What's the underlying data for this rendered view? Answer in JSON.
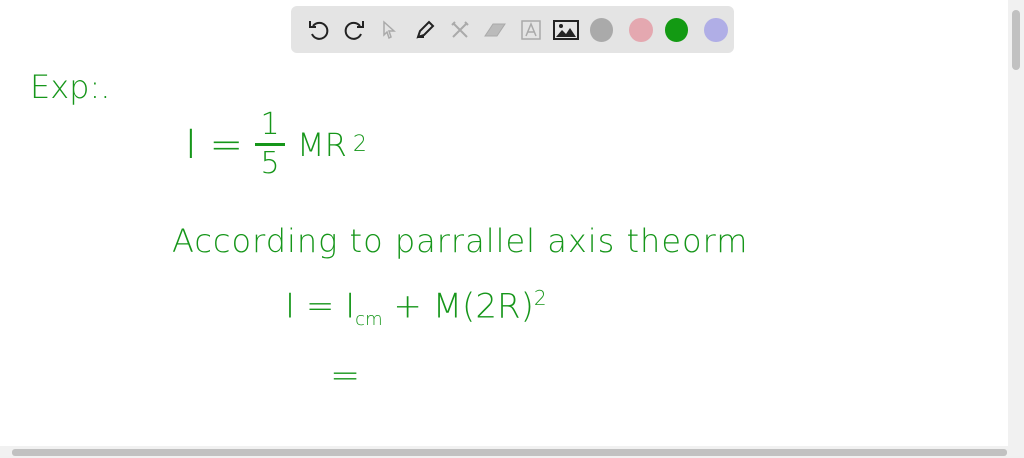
{
  "toolbar": {
    "tools": [
      "undo-icon",
      "redo-icon",
      "select-icon",
      "pen-icon",
      "tools-icon",
      "eraser-icon",
      "text-icon",
      "image-icon"
    ],
    "colors": [
      "#aaaaaa",
      "#e4a8b0",
      "#139a13",
      "#b0aee6"
    ],
    "selected_color": "#139a13"
  },
  "board": {
    "line1": "Exp:.",
    "line2_lhs": "I =",
    "line2_num": "1",
    "line2_den": "5",
    "line2_rhs": "MR",
    "line2_exp": "2",
    "line3": "According to parrallel axis theorm",
    "line4_main": "I = I",
    "line4_sub": "cm",
    "line4_rest": "+ M(2R)",
    "line4_exp": "2",
    "line5": "="
  }
}
